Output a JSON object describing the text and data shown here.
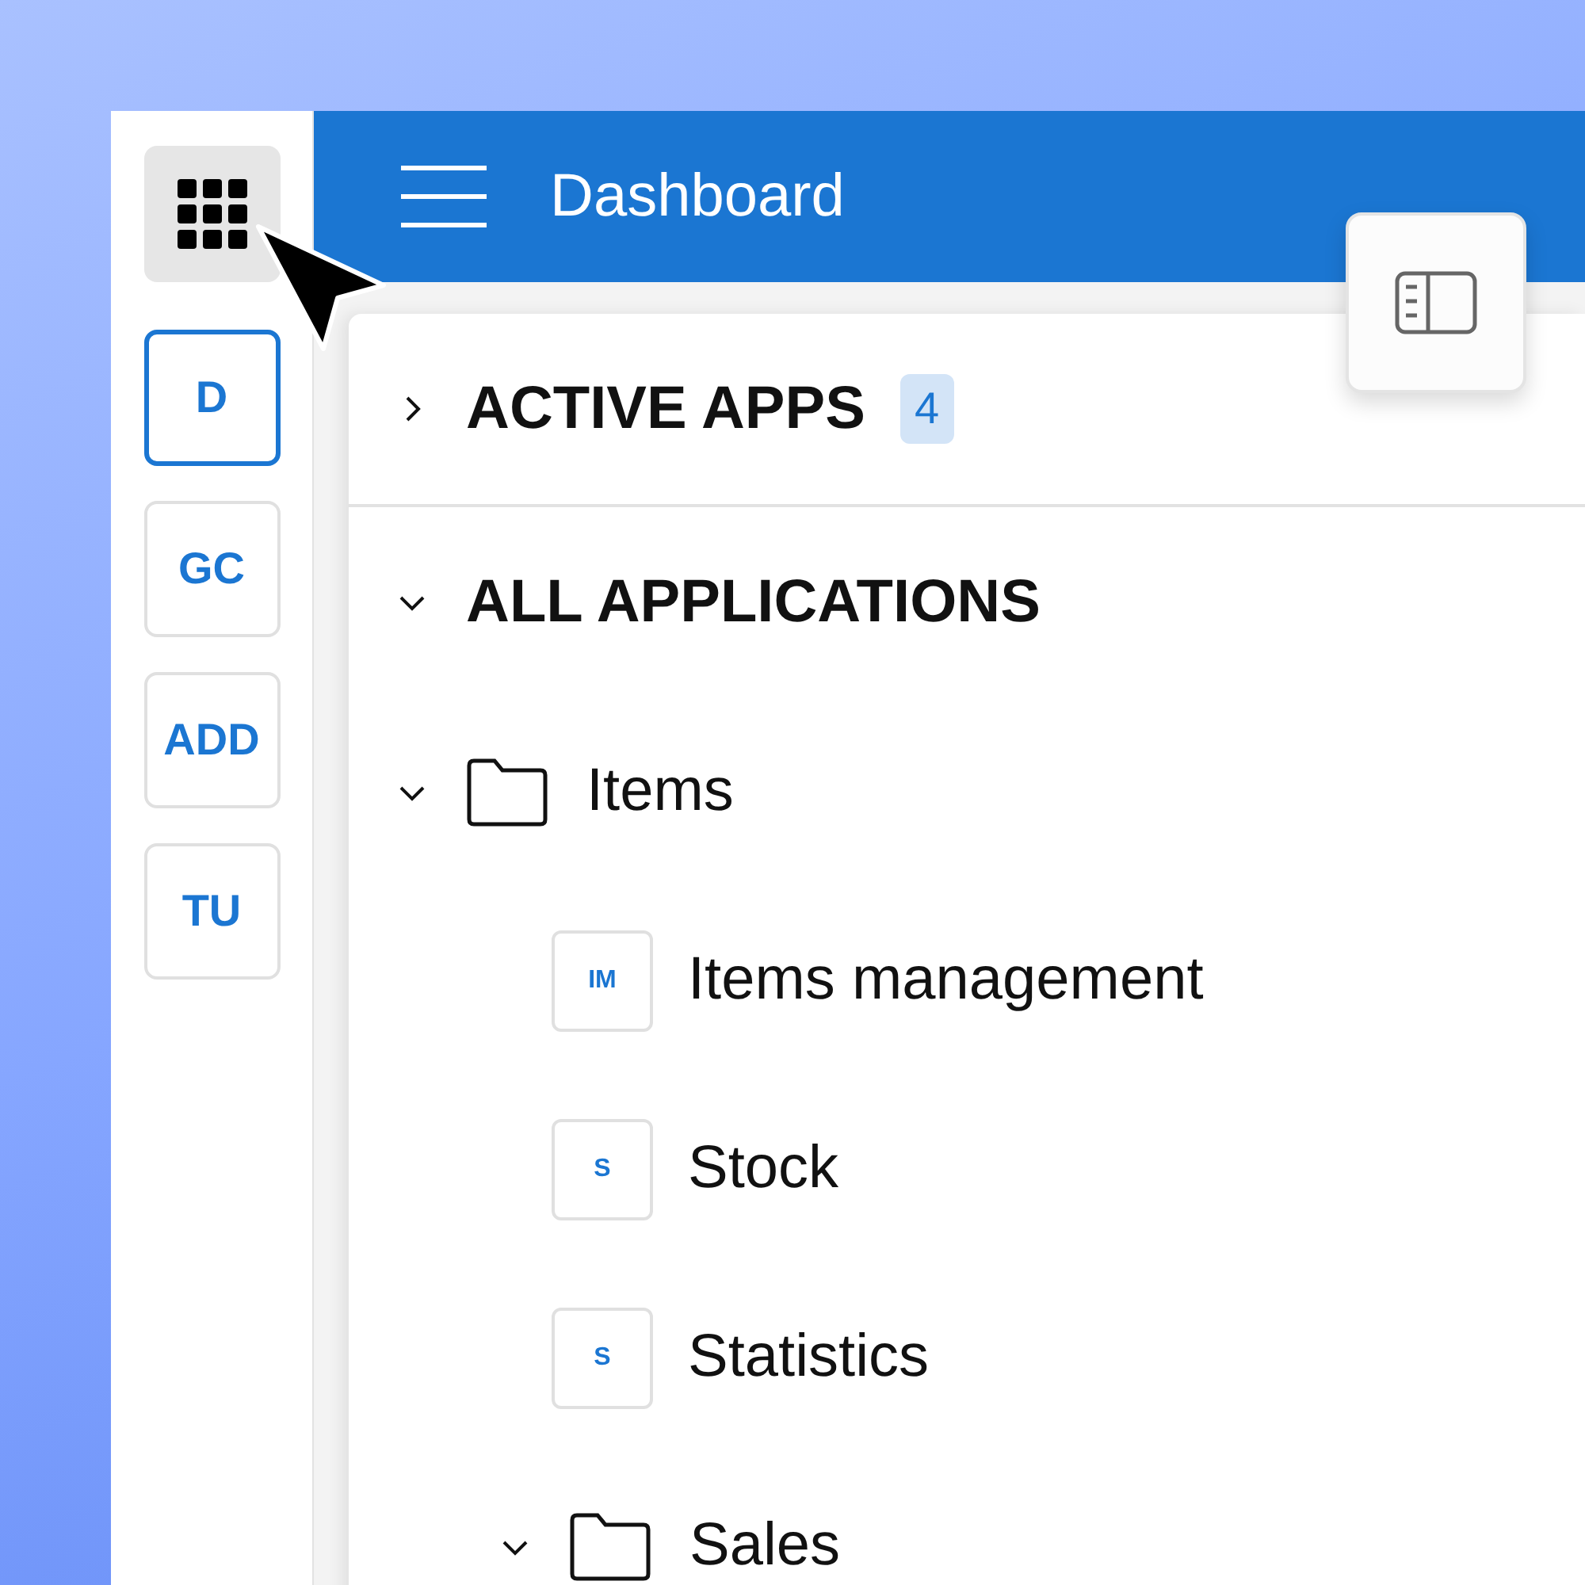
{
  "rail": {
    "items": [
      {
        "label": "D",
        "selected": true
      },
      {
        "label": "GC",
        "selected": false
      },
      {
        "label": "ADD",
        "selected": false
      },
      {
        "label": "TU",
        "selected": false
      }
    ]
  },
  "header": {
    "title": "Dashboard"
  },
  "sections": [
    {
      "title": "ACTIVE APPS",
      "count": "4",
      "expanded": false
    },
    {
      "title": "ALL APPLICATIONS",
      "expanded": true,
      "children": [
        {
          "kind": "folder",
          "label": "Items",
          "expanded": true,
          "children": [
            {
              "kind": "app",
              "initials": "IM",
              "label": "Items management"
            },
            {
              "kind": "app",
              "initials": "S",
              "label": "Stock"
            },
            {
              "kind": "app",
              "initials": "S",
              "label": "Statistics"
            },
            {
              "kind": "folder",
              "label": "Sales",
              "expanded": true
            }
          ]
        }
      ]
    }
  ]
}
